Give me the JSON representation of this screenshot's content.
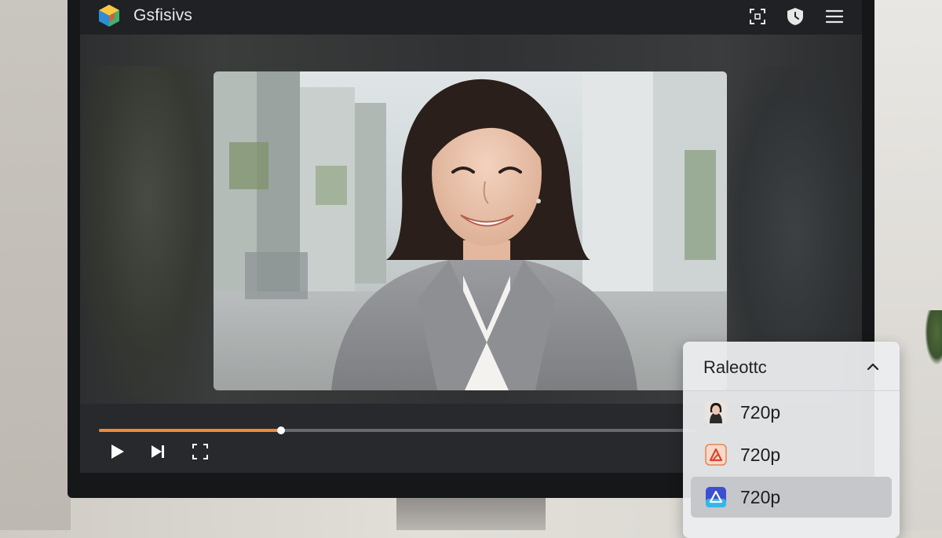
{
  "app": {
    "title": "Gsfisivs",
    "icons": [
      "app-logo-icon",
      "capture-icon",
      "shield-clock-icon",
      "hamburger-menu-icon"
    ]
  },
  "player": {
    "progress": 0.305,
    "accent_color": "#f08a3c",
    "controls": [
      "play-icon",
      "next-icon",
      "fullscreen-icon"
    ]
  },
  "quality_menu": {
    "title": "Raleottc",
    "expanded": true,
    "items": [
      {
        "label": "720p",
        "icon": "portrait-thumbnail-icon",
        "selected": false
      },
      {
        "label": "720p",
        "icon": "red-triangle-app-icon",
        "selected": false
      },
      {
        "label": "720p",
        "icon": "blue-triangle-app-icon",
        "selected": true
      }
    ]
  }
}
